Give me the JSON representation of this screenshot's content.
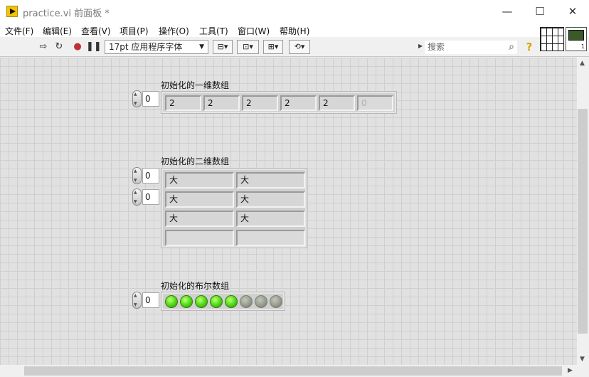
{
  "window": {
    "title": "practice.vi 前面板 *",
    "controls": {
      "minimize": "—",
      "maximize": "☐",
      "close": "✕"
    }
  },
  "menu": [
    "文件(F)",
    "编辑(E)",
    "查看(V)",
    "项目(P)",
    "操作(O)",
    "工具(T)",
    "窗口(W)",
    "帮助(H)"
  ],
  "toolbar": {
    "font": "17pt 应用程序字体",
    "search_placeholder": "搜索",
    "icons": [
      "run-arrow-icon",
      "run-continuously-icon",
      "abort-icon",
      "pause-icon",
      "align-objects-icon",
      "distribute-objects-icon",
      "resize-objects-icon",
      "reorder-icon",
      "search-icon",
      "context-help-icon"
    ]
  },
  "vi_icon": {
    "number": "1"
  },
  "arrays": {
    "one_d": {
      "label": "初始化的一维数组",
      "index": "0",
      "elements": [
        "2",
        "2",
        "2",
        "2",
        "2"
      ],
      "empty_element": "0"
    },
    "two_d": {
      "label": "初始化的二维数组",
      "row_index": "0",
      "col_index": "0",
      "rows": [
        [
          "大",
          "大"
        ],
        [
          "大",
          "大"
        ],
        [
          "大",
          "大"
        ]
      ]
    },
    "bool": {
      "label": "初始化的布尔数组",
      "index": "0",
      "values": [
        true,
        true,
        true,
        true,
        true
      ],
      "empty_count": 3
    }
  },
  "colors": {
    "led_on": "#57e21e",
    "led_off": "#969c8d",
    "canvas": "#e1e1e1"
  }
}
